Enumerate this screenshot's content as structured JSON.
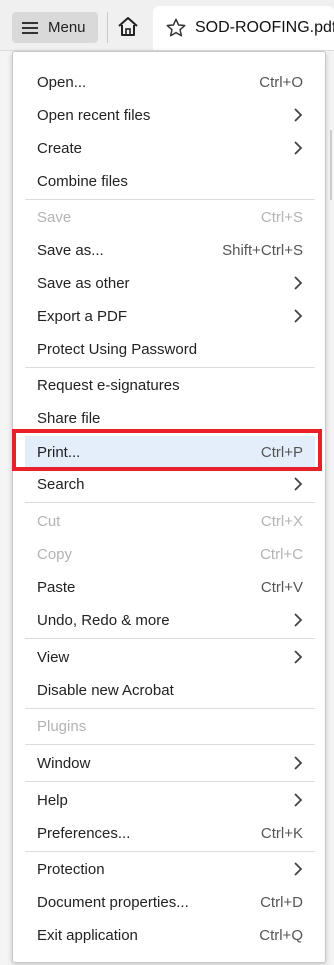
{
  "toolbar": {
    "menu_label": "Menu",
    "tab_title": "SOD-ROOFING.pdf"
  },
  "menu": {
    "items": [
      {
        "label": "Open...",
        "shortcut": "Ctrl+O"
      },
      {
        "label": "Open recent files"
      },
      {
        "label": "Create"
      },
      {
        "label": "Combine files"
      },
      {
        "label": "Save",
        "shortcut": "Ctrl+S"
      },
      {
        "label": "Save as...",
        "shortcut": "Shift+Ctrl+S"
      },
      {
        "label": "Save as other"
      },
      {
        "label": "Export a PDF"
      },
      {
        "label": "Protect Using Password"
      },
      {
        "label": "Request e-signatures"
      },
      {
        "label": "Share file"
      },
      {
        "label": "Print...",
        "shortcut": "Ctrl+P"
      },
      {
        "label": "Search"
      },
      {
        "label": "Cut",
        "shortcut": "Ctrl+X"
      },
      {
        "label": "Copy",
        "shortcut": "Ctrl+C"
      },
      {
        "label": "Paste",
        "shortcut": "Ctrl+V"
      },
      {
        "label": "Undo, Redo & more"
      },
      {
        "label": "View"
      },
      {
        "label": "Disable new Acrobat"
      },
      {
        "label": "Plugins"
      },
      {
        "label": "Window"
      },
      {
        "label": "Help"
      },
      {
        "label": "Preferences...",
        "shortcut": "Ctrl+K"
      },
      {
        "label": "Protection"
      },
      {
        "label": "Document properties...",
        "shortcut": "Ctrl+D"
      },
      {
        "label": "Exit application",
        "shortcut": "Ctrl+Q"
      }
    ]
  },
  "colors": {
    "highlight_border": "#e8202a",
    "highlight_fill": "#e3eefa",
    "disabled_text": "#b3b3b3"
  }
}
